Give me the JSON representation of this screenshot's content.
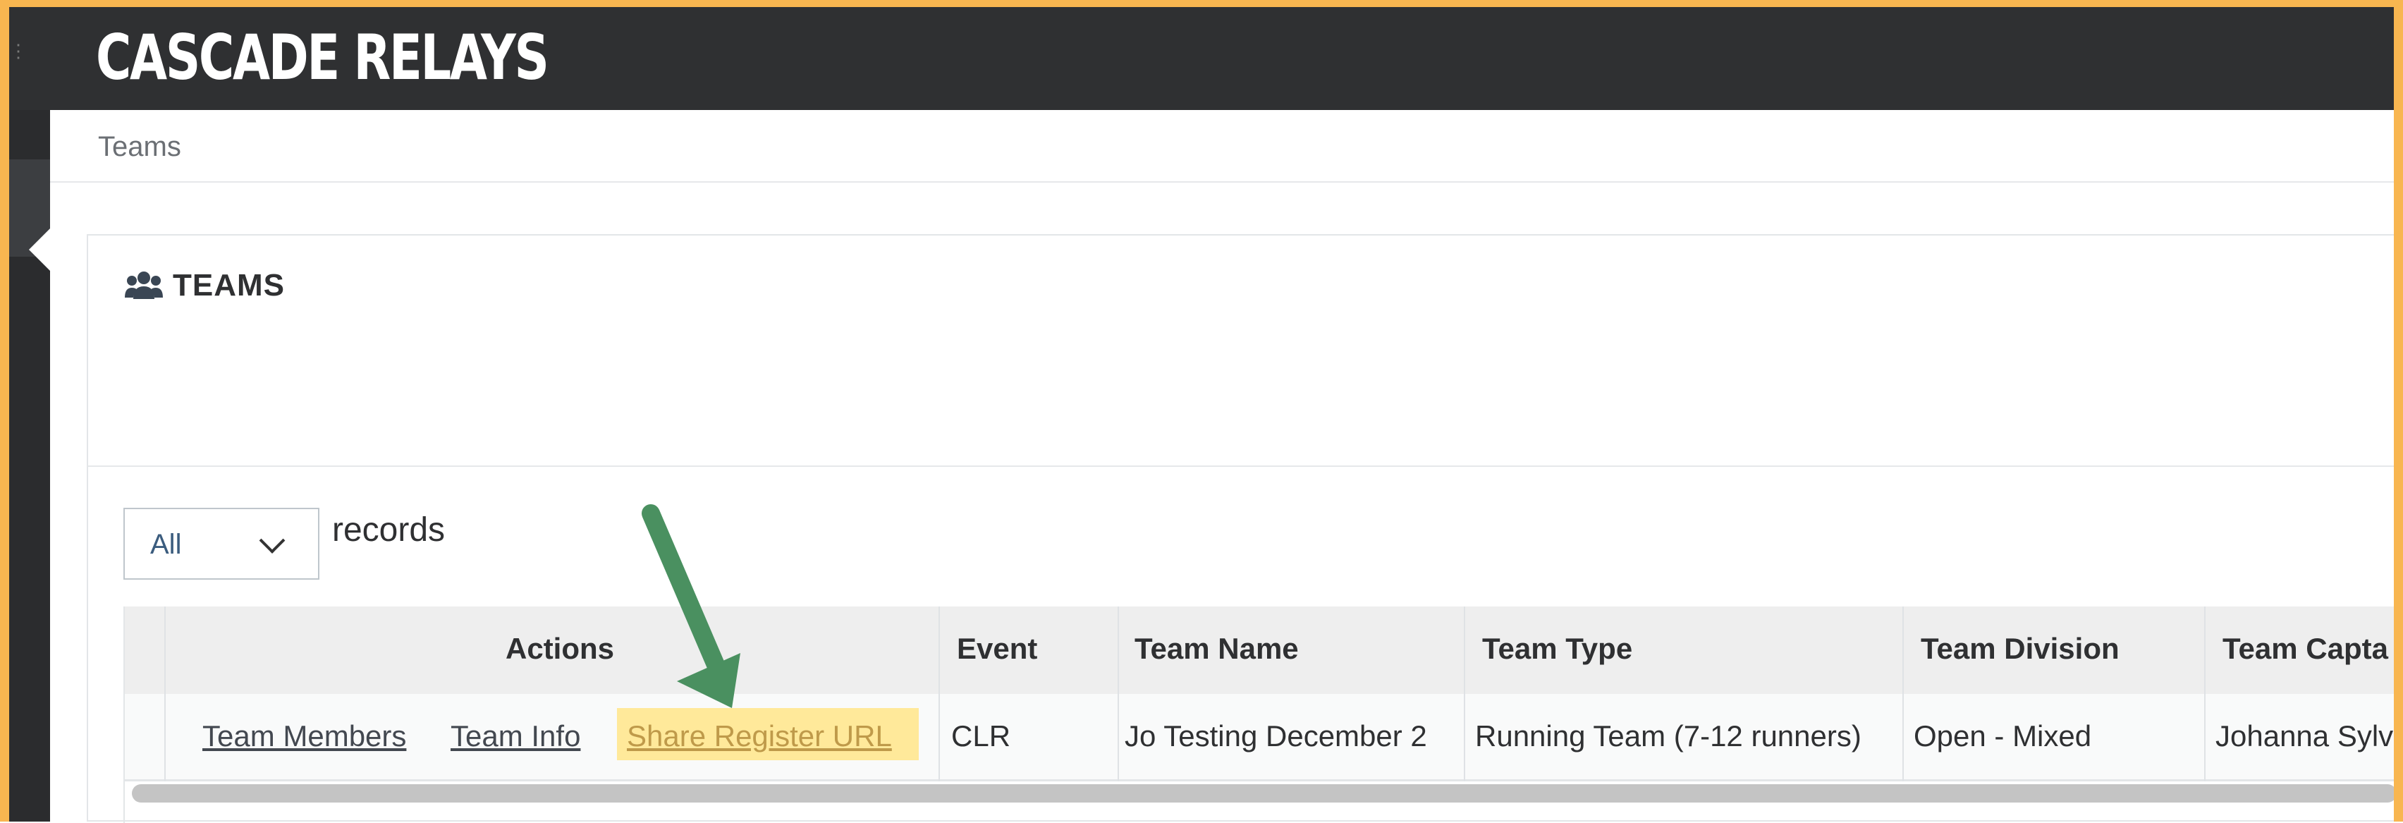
{
  "app": {
    "brand": "CASCADE RELAYS"
  },
  "breadcrumb": {
    "current": "Teams"
  },
  "panel": {
    "title": "TEAMS",
    "title_icon": "users-icon"
  },
  "records_selector": {
    "value": "All",
    "suffix_label": "records"
  },
  "table": {
    "headers": [
      "Actions",
      "Event",
      "Team Name",
      "Team Type",
      "Team Division",
      "Team Capta"
    ],
    "rows": [
      {
        "actions": [
          "Team Members",
          "Team Info",
          "Share Register URL"
        ],
        "event": "CLR",
        "team_name": "Jo Testing December 2",
        "team_type": "Running Team (7-12 runners)",
        "team_division": "Open - Mixed",
        "team_captain": "Johanna Sylv"
      }
    ]
  },
  "annotation": {
    "arrow_color": "#4a9060",
    "highlight_color": "#ffe99a",
    "frame_color": "#f8b650"
  }
}
